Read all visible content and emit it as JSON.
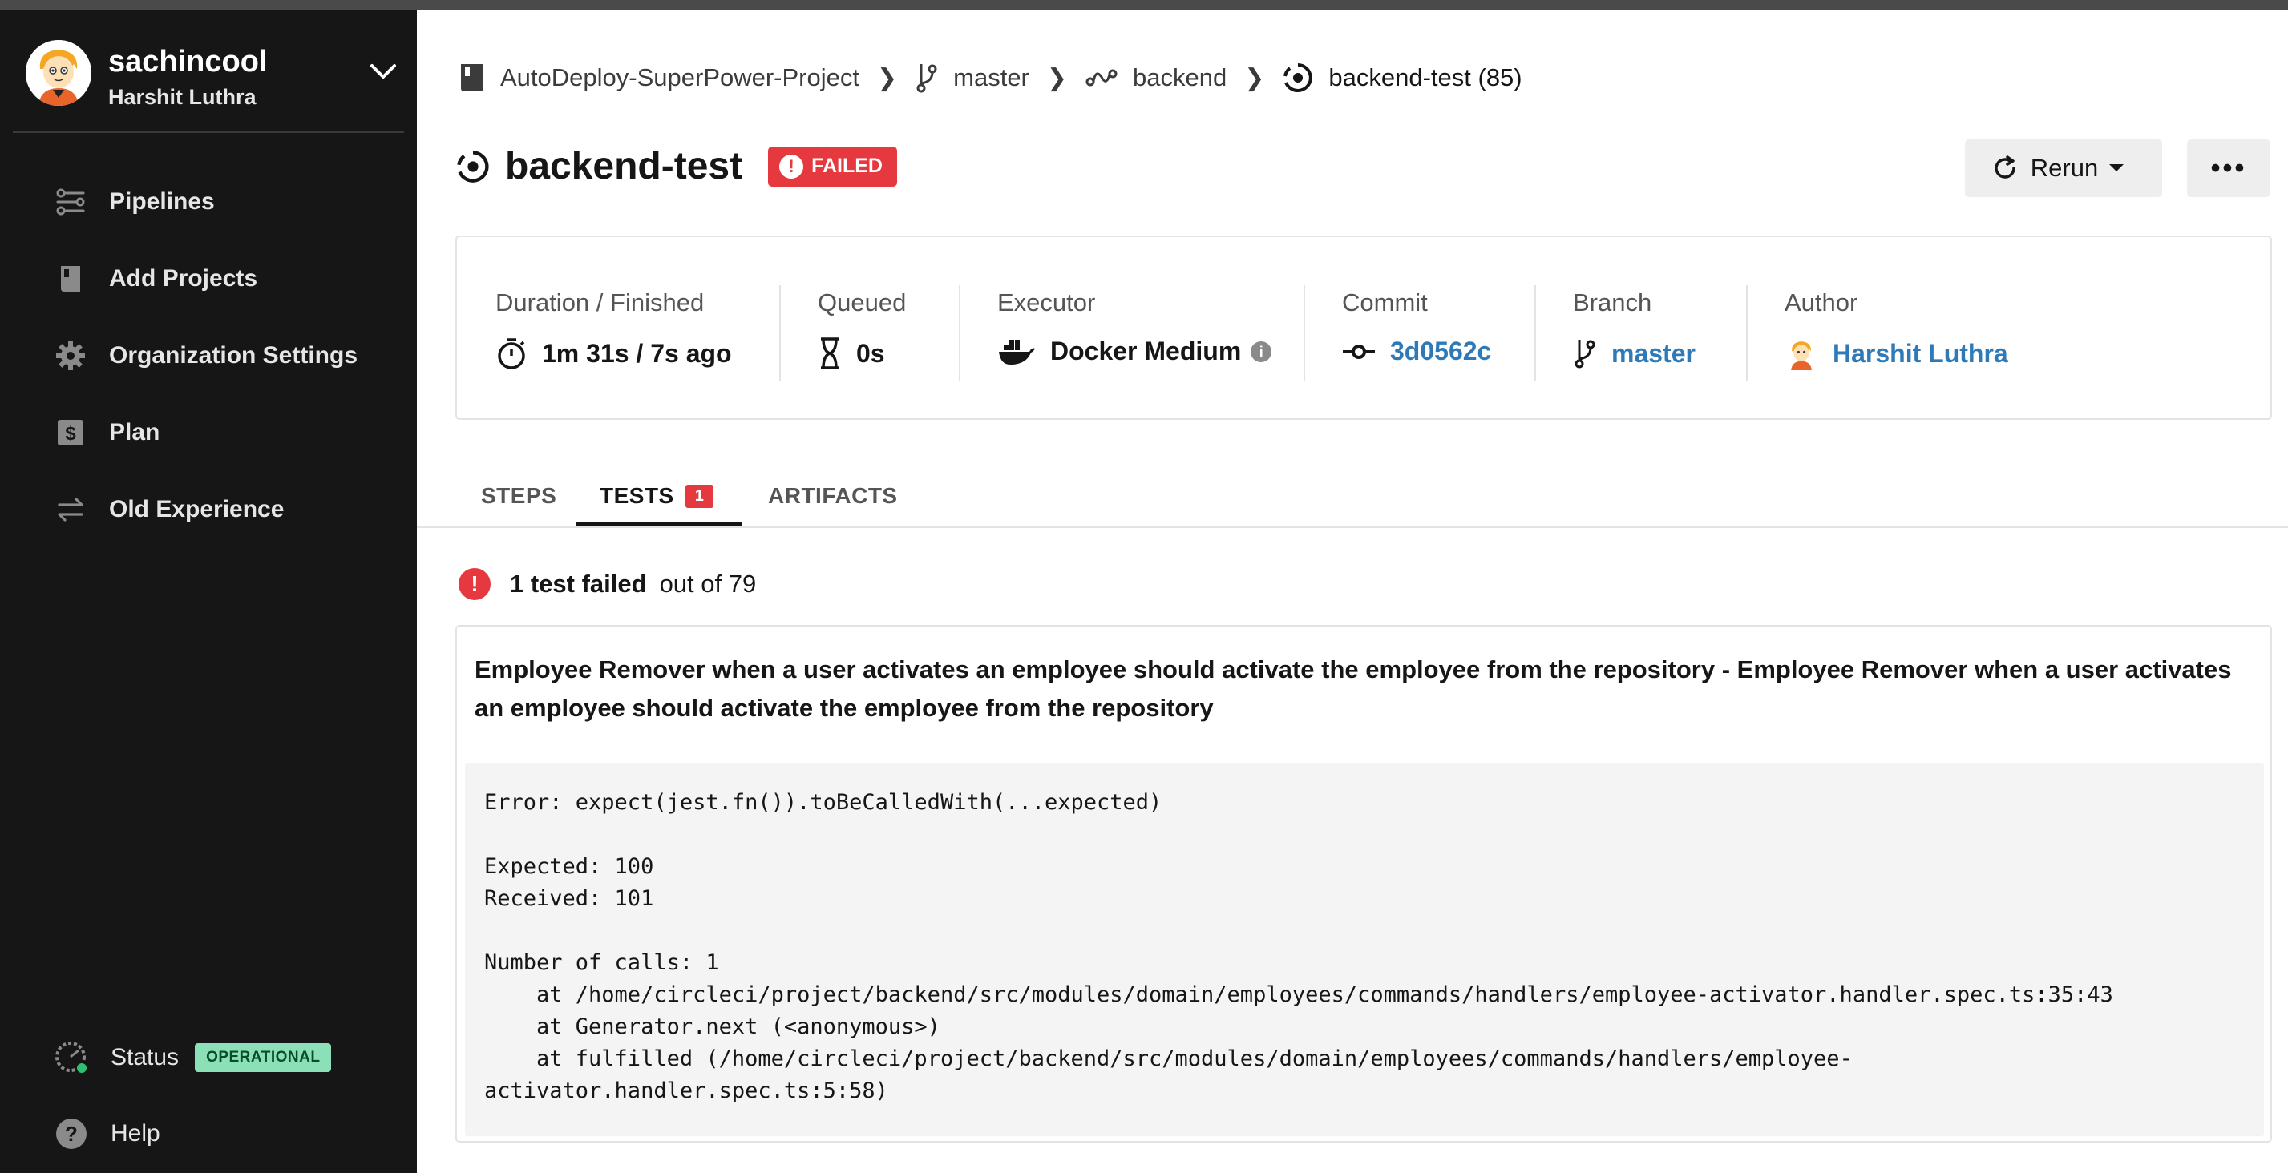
{
  "user": {
    "username": "sachincool",
    "full_name": "Harshit Luthra"
  },
  "sidebar": {
    "items": [
      {
        "label": "Pipelines",
        "icon": "pipelines-icon"
      },
      {
        "label": "Add Projects",
        "icon": "book-icon"
      },
      {
        "label": "Organization Settings",
        "icon": "gear-icon"
      },
      {
        "label": "Plan",
        "icon": "dollar-icon"
      },
      {
        "label": "Old Experience",
        "icon": "switch-icon"
      }
    ],
    "status_label": "Status",
    "status_badge": "OPERATIONAL",
    "help_label": "Help"
  },
  "breadcrumb": {
    "project": "AutoDeploy-SuperPower-Project",
    "branch": "master",
    "workflow": "backend",
    "job": "backend-test (85)"
  },
  "header": {
    "title": "backend-test",
    "status": "FAILED",
    "rerun_label": "Rerun",
    "more_label": "•••"
  },
  "meta": {
    "duration": {
      "label": "Duration / Finished",
      "value": "1m 31s / 7s ago"
    },
    "queued": {
      "label": "Queued",
      "value": "0s"
    },
    "executor": {
      "label": "Executor",
      "value": "Docker Medium"
    },
    "commit": {
      "label": "Commit",
      "value": "3d0562c"
    },
    "branch": {
      "label": "Branch",
      "value": "master"
    },
    "author": {
      "label": "Author",
      "value": "Harshit Luthra"
    }
  },
  "tabs": [
    {
      "label": "STEPS"
    },
    {
      "label": "TESTS",
      "count": "1"
    },
    {
      "label": "ARTIFACTS"
    }
  ],
  "tests": {
    "failed_text": "1 test failed",
    "out_of_text": "out of 79",
    "test_name": "Employee Remover when a user activates an employee should activate the employee from the repository - Employee Remover when a user activates an employee should activate the employee from the repository",
    "trace": "Error: expect(jest.fn()).toBeCalledWith(...expected)\n\nExpected: 100\nReceived: 101\n\nNumber of calls: 1\n    at /home/circleci/project/backend/src/modules/domain/employees/commands/handlers/employee-activator.handler.spec.ts:35:43\n    at Generator.next (<anonymous>)\n    at fulfilled (/home/circleci/project/backend/src/modules/domain/employees/commands/handlers/employee-\nactivator.handler.spec.ts:5:58)"
  },
  "colors": {
    "sidebar_bg": "#161616",
    "failed_red": "#e6383f",
    "link_blue": "#2e7ab8",
    "operational_green": "#8ce0b7"
  }
}
